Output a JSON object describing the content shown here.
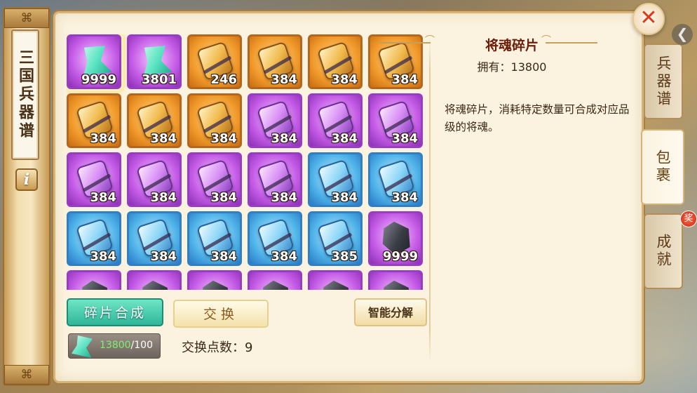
{
  "title": "三国兵器谱",
  "info_label": "i",
  "close_label": "✕",
  "back_label": "❮",
  "grid": [
    {
      "rarity": "jade",
      "frame": "sel",
      "count": "9999"
    },
    {
      "rarity": "jade",
      "frame": "purple",
      "count": "3801"
    },
    {
      "rarity": "gold",
      "frame": "orange",
      "count": "246"
    },
    {
      "rarity": "gold",
      "frame": "orange",
      "count": "384"
    },
    {
      "rarity": "gold",
      "frame": "orange",
      "count": "384"
    },
    {
      "rarity": "gold",
      "frame": "orange",
      "count": "384"
    },
    {
      "rarity": "gold",
      "frame": "orange",
      "count": "384"
    },
    {
      "rarity": "gold",
      "frame": "orange",
      "count": "384"
    },
    {
      "rarity": "gold",
      "frame": "orange",
      "count": "384"
    },
    {
      "rarity": "violet",
      "frame": "purple",
      "count": "384"
    },
    {
      "rarity": "violet",
      "frame": "purple",
      "count": "384"
    },
    {
      "rarity": "violet",
      "frame": "purple",
      "count": "384"
    },
    {
      "rarity": "violet",
      "frame": "purple",
      "count": "384"
    },
    {
      "rarity": "violet",
      "frame": "purple",
      "count": "384"
    },
    {
      "rarity": "violet",
      "frame": "purple",
      "count": "384"
    },
    {
      "rarity": "violet",
      "frame": "purple",
      "count": "384"
    },
    {
      "rarity": "ice",
      "frame": "blue",
      "count": "384"
    },
    {
      "rarity": "ice",
      "frame": "blue",
      "count": "384"
    },
    {
      "rarity": "ice",
      "frame": "blue",
      "count": "384"
    },
    {
      "rarity": "ice",
      "frame": "blue",
      "count": "384"
    },
    {
      "rarity": "ice",
      "frame": "blue",
      "count": "384"
    },
    {
      "rarity": "ice",
      "frame": "blue",
      "count": "384"
    },
    {
      "rarity": "ice",
      "frame": "blue",
      "count": "385"
    },
    {
      "rarity": "ore",
      "frame": "purple",
      "count": "9999"
    },
    {
      "rarity": "ore",
      "frame": "purple",
      "count": ""
    },
    {
      "rarity": "ore",
      "frame": "purple",
      "count": ""
    },
    {
      "rarity": "ore",
      "frame": "purple",
      "count": ""
    },
    {
      "rarity": "ore",
      "frame": "purple",
      "count": ""
    },
    {
      "rarity": "ore",
      "frame": "purple",
      "count": ""
    },
    {
      "rarity": "ore",
      "frame": "purple",
      "count": ""
    }
  ],
  "buttons": {
    "synthesize": "碎片合成",
    "exchange": "交换",
    "decompose": "智能分解"
  },
  "stock": {
    "have": "13800",
    "need": "/100"
  },
  "exchange_points": "交换点数：9",
  "detail": {
    "name": "将魂碎片",
    "owned": "拥有：13800",
    "description": "将魂碎片，消耗特定数量可合成对应品级的将魂。"
  },
  "tabs": {
    "weapons": "兵器谱",
    "bag": "包裹",
    "achievement": "成就",
    "reward_badge": "奖"
  }
}
